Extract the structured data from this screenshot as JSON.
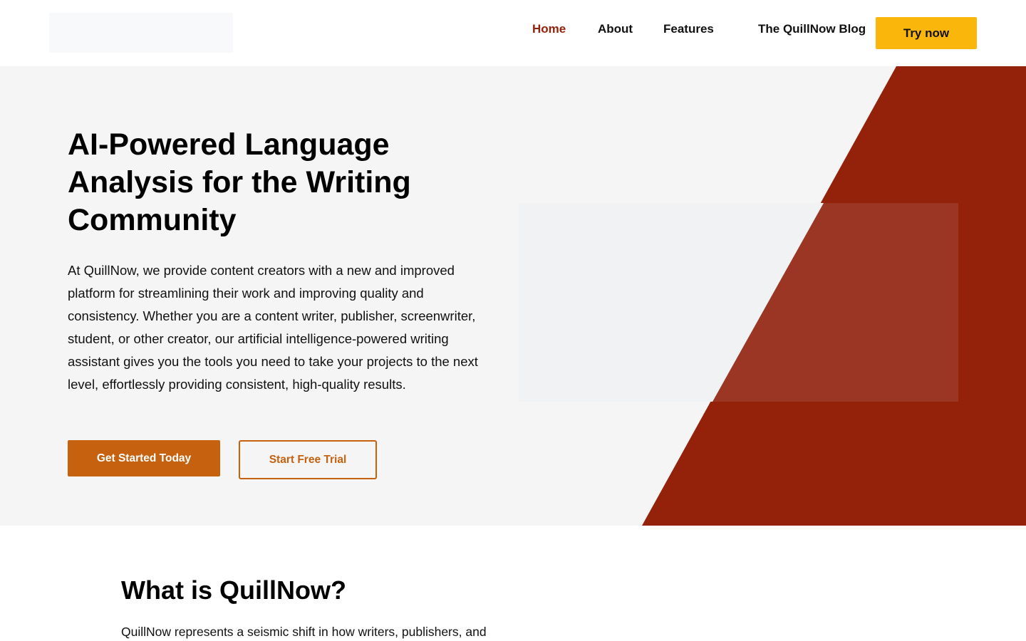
{
  "header": {
    "nav": [
      {
        "label": "Home"
      },
      {
        "label": "About"
      },
      {
        "label": "Features"
      },
      {
        "label": "The QuillNow Blog"
      }
    ],
    "cta_label": "Try now"
  },
  "hero": {
    "title": "AI-Powered Language Analysis for the Writing Community",
    "description": "At QuillNow, we provide content creators with a new and improved platform for streamlining their work and improving quality and consistency. Whether you are a content writer, publisher, screenwriter, student, or other creator, our artificial intelligence-powered writing assistant gives you the tools you need to take your projects to the next level, effortlessly providing consistent, high-quality results.",
    "primary_button": "Get Started Today",
    "secondary_button": "Start Free Trial"
  },
  "about": {
    "title": "What is QuillNow?",
    "text": "QuillNow represents a seismic shift in how writers, publishers, and"
  },
  "colors": {
    "accent_red": "#94220b",
    "accent_orange": "#c5610f",
    "cta_yellow": "#fbb60b",
    "hero_bg": "#f5f5f5"
  }
}
